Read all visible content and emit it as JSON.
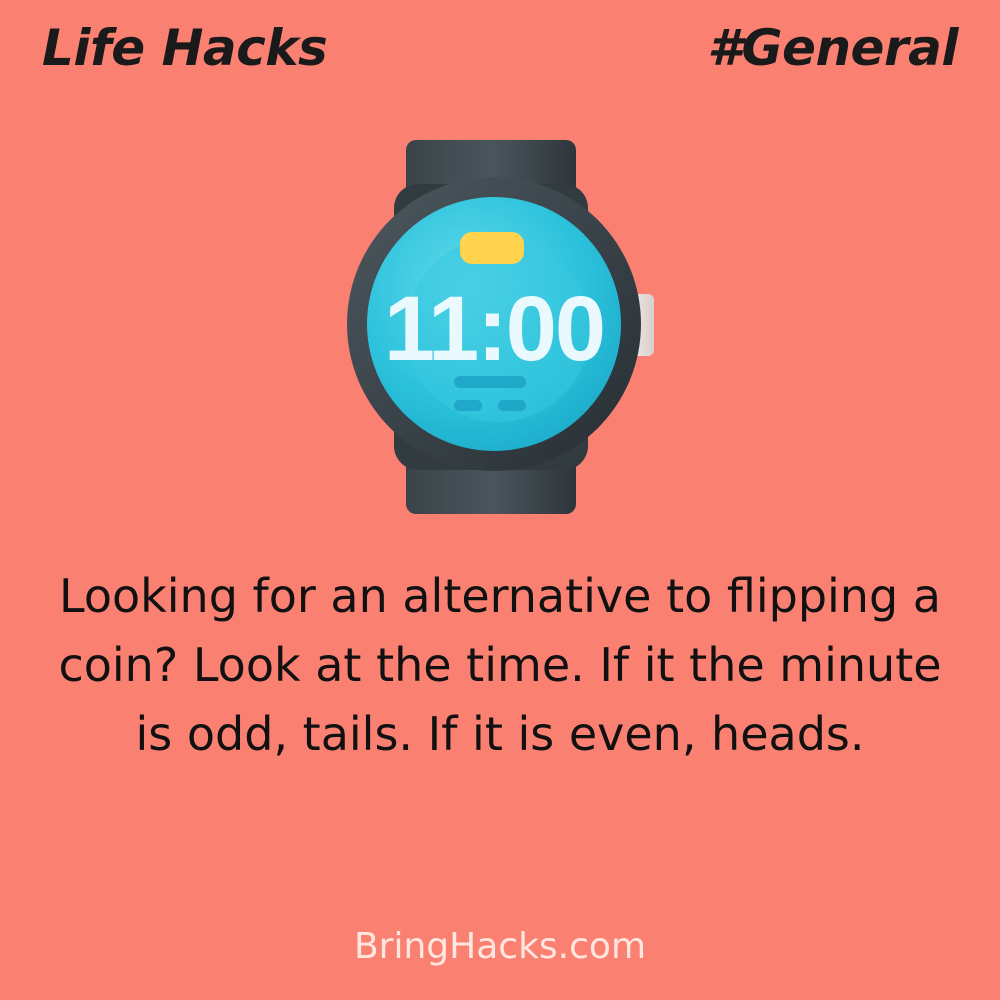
{
  "header": {
    "title": "Life Hacks",
    "category": "#General"
  },
  "illustration": {
    "icon": "smartwatch-icon",
    "time_display": "11:00"
  },
  "tip": {
    "text": "Looking for an alternative to flipping a coin? Look at the time. If it the minute is odd, tails. If it is even, heads."
  },
  "footer": {
    "site": "BringHacks.com"
  },
  "colors": {
    "background": "#fa8072",
    "heading": "#1a1a1a",
    "body_text": "#111111",
    "footer_text": "#ffe6de",
    "watch_screen": "#2fc7df",
    "watch_body": "#3c454b",
    "watch_pill": "#ffd34e"
  }
}
